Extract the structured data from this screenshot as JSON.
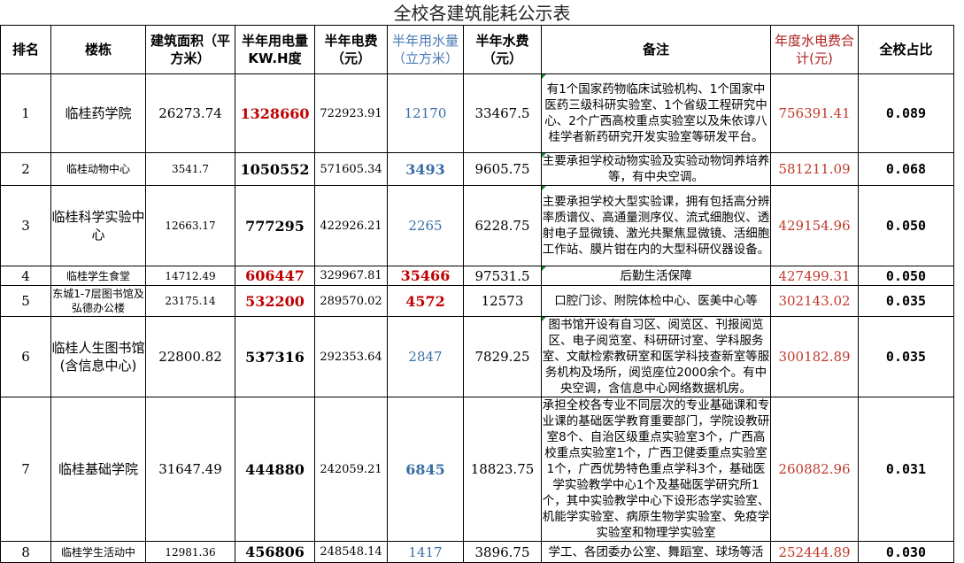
{
  "title": "全校各建筑能耗公示表",
  "headers": {
    "rank": "排名",
    "building": "楼栋",
    "area": "建筑面积（平方米）",
    "elec_use": "半年用电量KW.H度",
    "elec_fee": "半年电费（元）",
    "water_use": "半年用水量（立方米）",
    "water_fee": "半年水费（元）",
    "notes": "备注",
    "total": "年度水电费合计(元)",
    "share": "全校占比"
  },
  "rows": [
    {
      "rank": "1",
      "building": "临桂药学院",
      "area": "26273.74",
      "elec_use": "1328660",
      "elec_fee": "722923.91",
      "water_use": "12170",
      "water_fee": "33467.5",
      "notes": "有1个国家药物临床试验机构、1个国家中医药三级科研实验室、1个省级工程研究中心、2个广西高校重点实验室以及朱依谆八桂学者新药研究开发实验室等研发平台。",
      "total": "756391.41",
      "share": "0.089"
    },
    {
      "rank": "2",
      "building": "临桂动物中心",
      "area": "3541.7",
      "elec_use": "1050552",
      "elec_fee": "571605.34",
      "water_use": "3493",
      "water_fee": "9605.75",
      "notes": "主要承担学校动物实验及实验动物饲养培养等，有中央空调。",
      "total": "581211.09",
      "share": "0.068"
    },
    {
      "rank": "3",
      "building": "临桂科学实验中心",
      "area": "12663.17",
      "elec_use": "777295",
      "elec_fee": "422926.21",
      "water_use": "2265",
      "water_fee": "6228.75",
      "notes": "主要承担学校大型实验课，拥有包括高分辨率质谱仪、高通量测序仪、流式细胞仪、透射电子显微镜、激光共聚焦显微镜、活细胞工作站、膜片钳在内的大型科研仪器设备。",
      "total": "429154.96",
      "share": "0.050"
    },
    {
      "rank": "4",
      "building": "临桂学生食堂",
      "area": "14712.49",
      "elec_use": "606447",
      "elec_fee": "329967.81",
      "water_use": "35466",
      "water_fee": "97531.5",
      "notes": "后勤生活保障",
      "total": "427499.31",
      "share": "0.050"
    },
    {
      "rank": "5",
      "building": "东城1-7层图书馆及弘德办公楼",
      "area": "23175.14",
      "elec_use": "532200",
      "elec_fee": "289570.02",
      "water_use": "4572",
      "water_fee": "12573",
      "notes": "口腔门诊、附院体检中心、医美中心等",
      "total": "302143.02",
      "share": "0.035"
    },
    {
      "rank": "6",
      "building": "临桂人生图书馆(含信息中心)",
      "area": "22800.82",
      "elec_use": "537316",
      "elec_fee": "292353.64",
      "water_use": "2847",
      "water_fee": "7829.25",
      "notes": "图书馆开设有自习区、阅览区、刊报阅览区、电子阅览室、科研研讨室、学科服务室、文献检索教研室和医学科技查新室等服务机构及场所，阅览座位2000余个。有中央空调，含信息中心网络数据机房。",
      "total": "300182.89",
      "share": "0.035"
    },
    {
      "rank": "7",
      "building": "临桂基础学院",
      "area": "31647.49",
      "elec_use": "444880",
      "elec_fee": "242059.21",
      "water_use": "6845",
      "water_fee": "18823.75",
      "notes": "承担全校各专业不同层次的专业基础课和专业课的基础医学教育重要部门，学院设教研室8个、自治区级重点实验室3个，广西高校重点实验室1个，广西卫健委重点实验室1个，广西优势特色重点学科3个，基础医学实验教学中心1个及基础医学研究所1个，其中实验教学中心下设形态学实验室、机能学实验室、病原生物学实验室、免疫学实验室和物理学实验室",
      "total": "260882.96",
      "share": "0.031"
    },
    {
      "rank": "8",
      "building": "临桂学生活动中",
      "area": "12981.36",
      "elec_use": "456806",
      "elec_fee": "248548.14",
      "water_use": "1417",
      "water_fee": "3896.75",
      "notes": "学工、各团委办公室、舞蹈室、球场等活",
      "total": "252444.89",
      "share": "0.030"
    }
  ]
}
